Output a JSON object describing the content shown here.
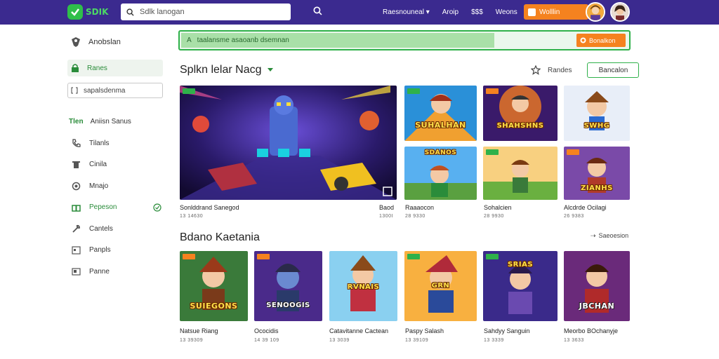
{
  "app": {
    "logo_text": "SDIK",
    "search_placeholder": "Sdlk lanogan"
  },
  "topnav": {
    "links": [
      "Raesnouneal ▾",
      "Aroip",
      "$$$",
      "Weons"
    ],
    "cta_label": "Wolllin"
  },
  "sidebar": {
    "header": "Anobslan",
    "active_item": "Ranes",
    "input_value": "sapalsdenma",
    "section_tag": "Tlen",
    "section_label": "Aniisn Sanus",
    "items": [
      {
        "label": "Tilanls",
        "icon": "phone-icon"
      },
      {
        "label": "Cinila",
        "icon": "trash-icon"
      },
      {
        "label": "Mnajo",
        "icon": "refresh-icon"
      },
      {
        "label": "Pepeson",
        "icon": "gift-icon",
        "active": true
      },
      {
        "label": "Cantels",
        "icon": "wrench-icon"
      },
      {
        "label": "Panpls",
        "icon": "calendar-icon"
      },
      {
        "label": "Panne",
        "icon": "card-icon"
      }
    ]
  },
  "banner": {
    "text": "taalansme asaoanb dsemnan",
    "button_label": "Bonalkon"
  },
  "featured": {
    "title": "Splkn lelar Nacg",
    "sort_label": "Randes",
    "button_label": "Bancalon",
    "main": {
      "name": "Sonlddrand Sanegod",
      "meta": "13 14630",
      "right_name": "Baod",
      "right_meta": "1300I"
    },
    "tiles": [
      {
        "caption": "SUHALHAN",
        "name": "Raaaocon",
        "meta": "28 9330"
      },
      {
        "caption": "SHAHSHNS",
        "name": "",
        "meta": ""
      },
      {
        "caption": "SWHG",
        "name": "",
        "meta": ""
      },
      {
        "caption": "SDANOS",
        "name": "Sohalcien",
        "meta": "28 9930"
      },
      {
        "caption": "",
        "name": "",
        "meta": ""
      },
      {
        "caption": "ZIANHS",
        "name": "Alcdrde Ocilagi",
        "meta": "26 9383"
      }
    ]
  },
  "recent": {
    "title": "Bdano Kaetania",
    "see_all": "Saeoesion",
    "items": [
      {
        "caption": "SUIEGONS",
        "name": "Natsue Riang",
        "meta": "13 39309"
      },
      {
        "caption": "SENOOGIS",
        "name": "Ococidis",
        "meta": "14 39 109"
      },
      {
        "caption": "RVNAIS",
        "name": "Catavitanne Cactean",
        "meta": "13 3039"
      },
      {
        "caption": "GRN",
        "name": "Paspy Salash",
        "meta": "13 39109"
      },
      {
        "caption": "SRIAS",
        "name": "Sahdyy Sanguin",
        "meta": "13 3339"
      },
      {
        "caption": "JBCHAN",
        "name": "Meorbo BOchanyje",
        "meta": "13 3633"
      }
    ]
  },
  "colors": {
    "topbar": "#3b2a8f",
    "accent_green": "#2fb14a",
    "cta_orange": "#f5821f"
  }
}
